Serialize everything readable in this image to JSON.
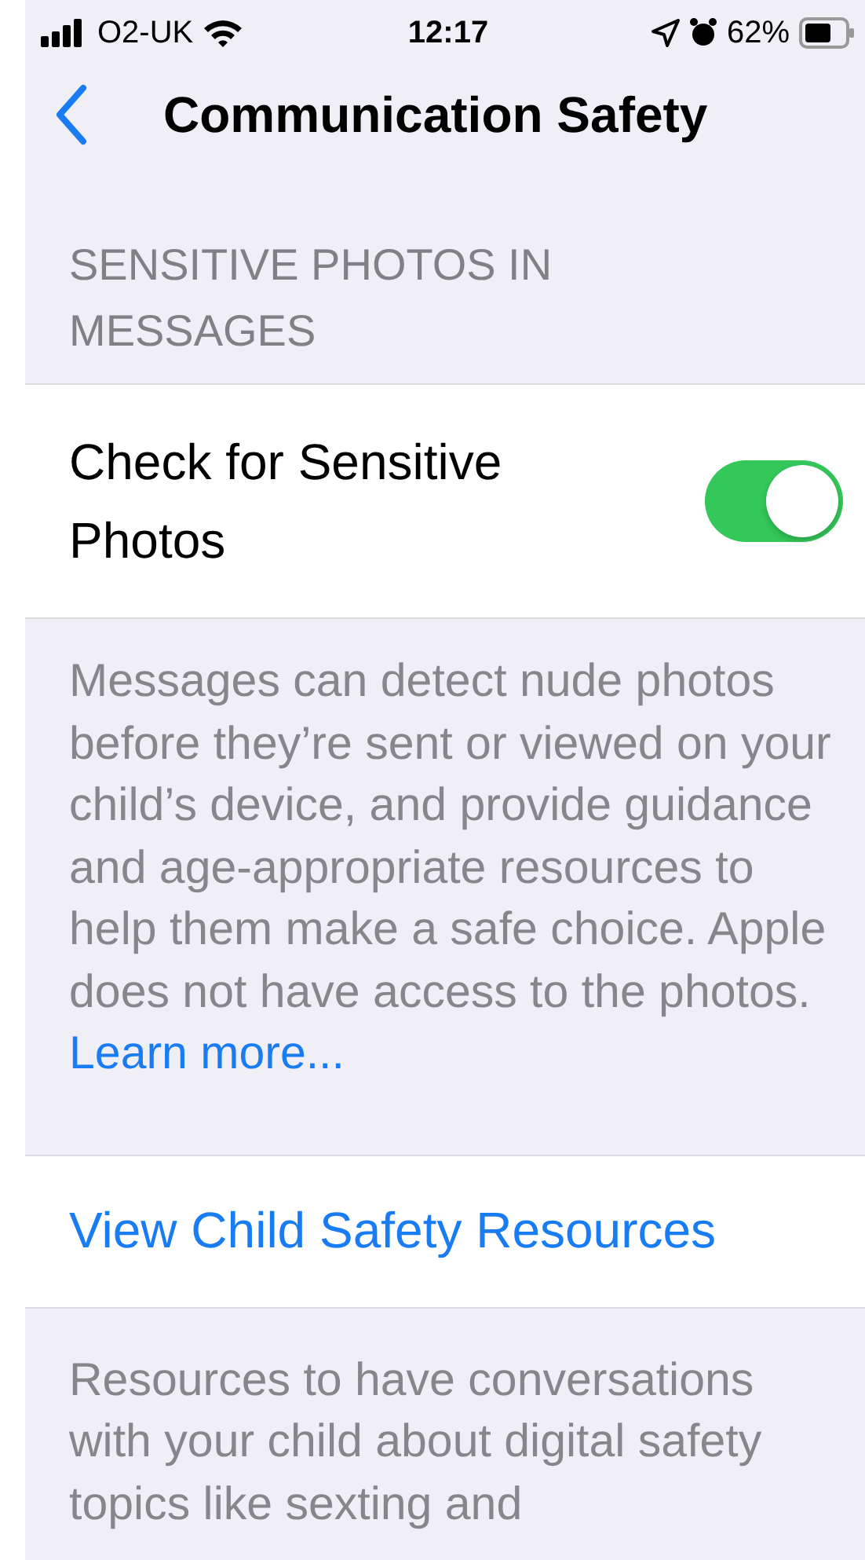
{
  "status_bar": {
    "carrier": "O2-UK",
    "time": "12:17",
    "battery": "62%"
  },
  "nav": {
    "title": "Communication Safety"
  },
  "section": {
    "header": "SENSITIVE PHOTOS IN MESSAGES",
    "toggle_row": {
      "label": "Check for Sensitive Photos",
      "on": true
    },
    "footer": "Messages can detect nude photos before they’re sent or viewed on your child’s device, and provide guidance and age-appropriate resources to help them make a safe choice. Apple does not have access to the photos.",
    "footer_link": "Learn more..."
  },
  "resources": {
    "link": "View Child Safety Resources",
    "footer": "Resources to have conversations with your child about digital safety topics like sexting and"
  }
}
